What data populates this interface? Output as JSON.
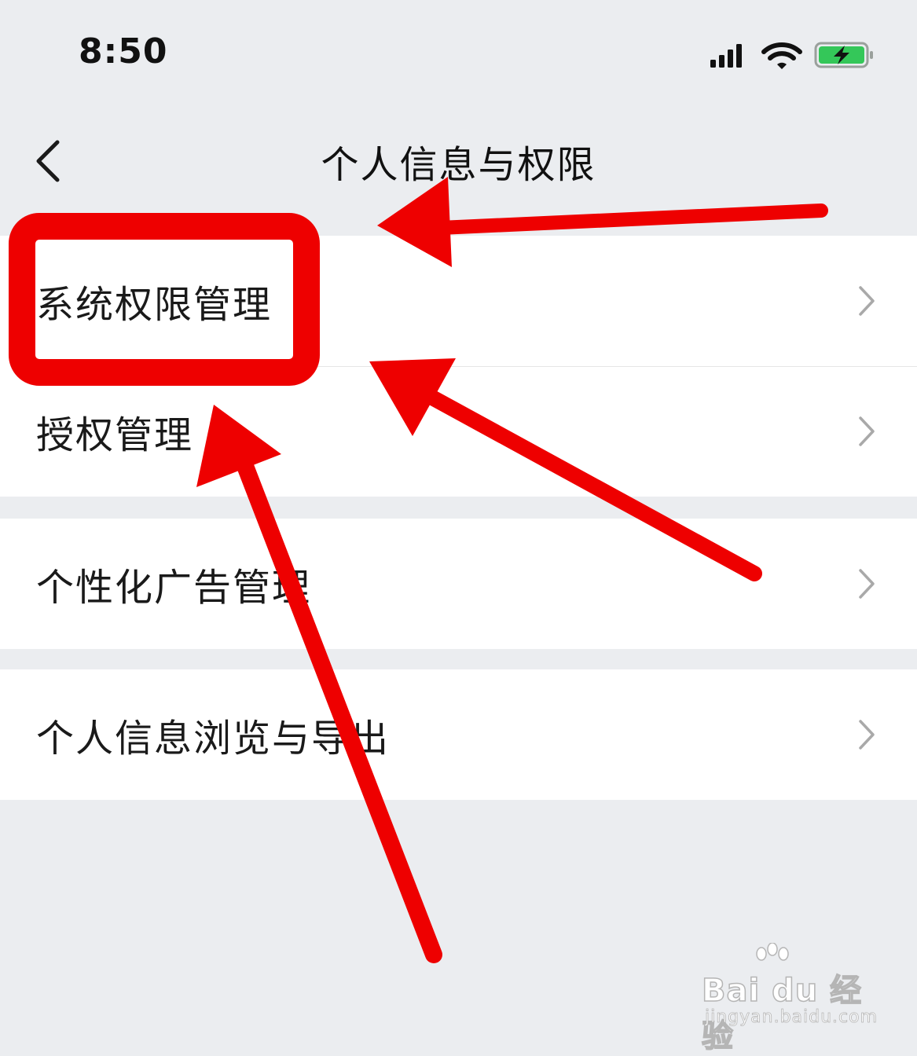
{
  "status_bar": {
    "time": "8:50",
    "icons": [
      "cellular-signal-icon",
      "wifi-icon",
      "battery-charging-icon"
    ],
    "battery_color": "#34c759"
  },
  "nav": {
    "title": "个人信息与权限",
    "back_icon": "chevron-left-icon"
  },
  "menu": {
    "groups": [
      {
        "items": [
          {
            "label": "系统权限管理"
          },
          {
            "label": "授权管理"
          }
        ]
      },
      {
        "items": [
          {
            "label": "个性化广告管理"
          }
        ]
      },
      {
        "items": [
          {
            "label": "个人信息浏览与导出"
          }
        ]
      }
    ],
    "chevron_icon": "chevron-right-icon"
  },
  "annotation": {
    "color": "#ee0000",
    "highlight": "red-box-around-系统权限管理",
    "arrows": 3
  },
  "watermark": {
    "brand": "Bai du 经验",
    "url": "jingyan.baidu.com"
  }
}
